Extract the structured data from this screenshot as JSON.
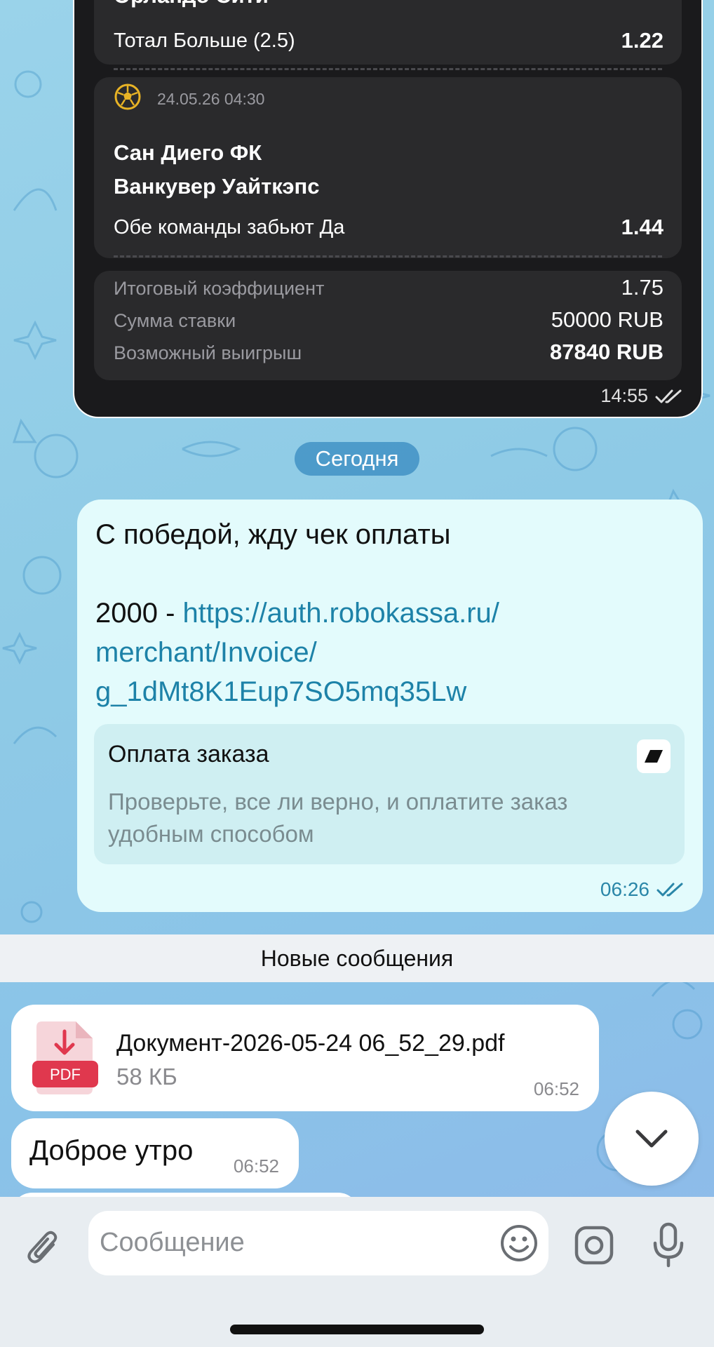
{
  "bet_slip": {
    "match1_team_partial": "Орландо Сити",
    "match1_market": "Тотал Больше (2.5)",
    "match1_odd": "1.22",
    "match2_datetime": "24.05.26 04:30",
    "match2_team1": "Сан Диего ФК",
    "match2_team2": "Ванкувер Уайткэпс",
    "match2_market": "Обе команды забьют Да",
    "match2_odd": "1.44",
    "total_odds_label": "Итоговый коэффициент",
    "total_odds_value": "1.75",
    "stake_label": "Сумма ставки",
    "stake_value": "50000 RUB",
    "payout_label": "Возможный выигрыш",
    "payout_value": "87840 RUB",
    "time": "14:55"
  },
  "date_divider": "Сегодня",
  "outgoing_message": {
    "line1": "С победой, жду чек оплаты",
    "amount": "2000 - ",
    "link_line1": "https://auth.robokassa.ru/",
    "link_line2": "merchant/Invoice/",
    "link_line3": "g_1dMt8K1Eup7SO5mq35Lw",
    "preview_title": "Оплата заказа",
    "preview_description": "Проверьте, все ли верно, и оплатите заказ удобным способом",
    "time": "06:26"
  },
  "new_messages_label": "Новые сообщения",
  "file_message": {
    "file_name": "Документ-2026-05-24 06_52_29.pdf",
    "file_size": "58 КБ",
    "file_type_label": "PDF",
    "time": "06:52"
  },
  "text_message": {
    "text": "Доброе утро",
    "time": "06:52"
  },
  "input": {
    "placeholder": "Сообщение"
  },
  "colors": {
    "link": "#1d82a8",
    "outgoing_bubble": "#e3fbfc",
    "pdf_red": "#e0384e"
  }
}
